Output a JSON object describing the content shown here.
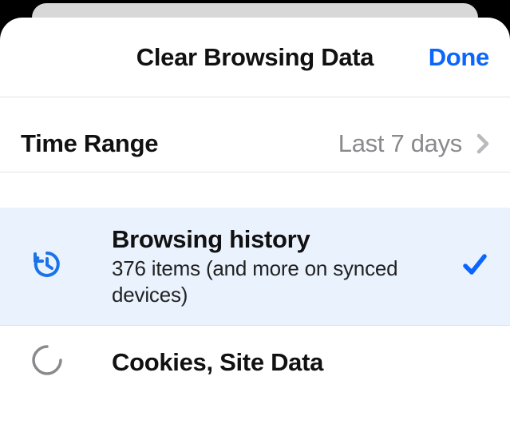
{
  "header": {
    "title": "Clear Browsing Data",
    "done_label": "Done"
  },
  "time_range": {
    "label": "Time Range",
    "value": "Last 7 days"
  },
  "items": {
    "browsing_history": {
      "title": "Browsing history",
      "subtitle": "376 items (and more on synced devices)"
    },
    "cookies": {
      "title": "Cookies, Site Data"
    }
  }
}
